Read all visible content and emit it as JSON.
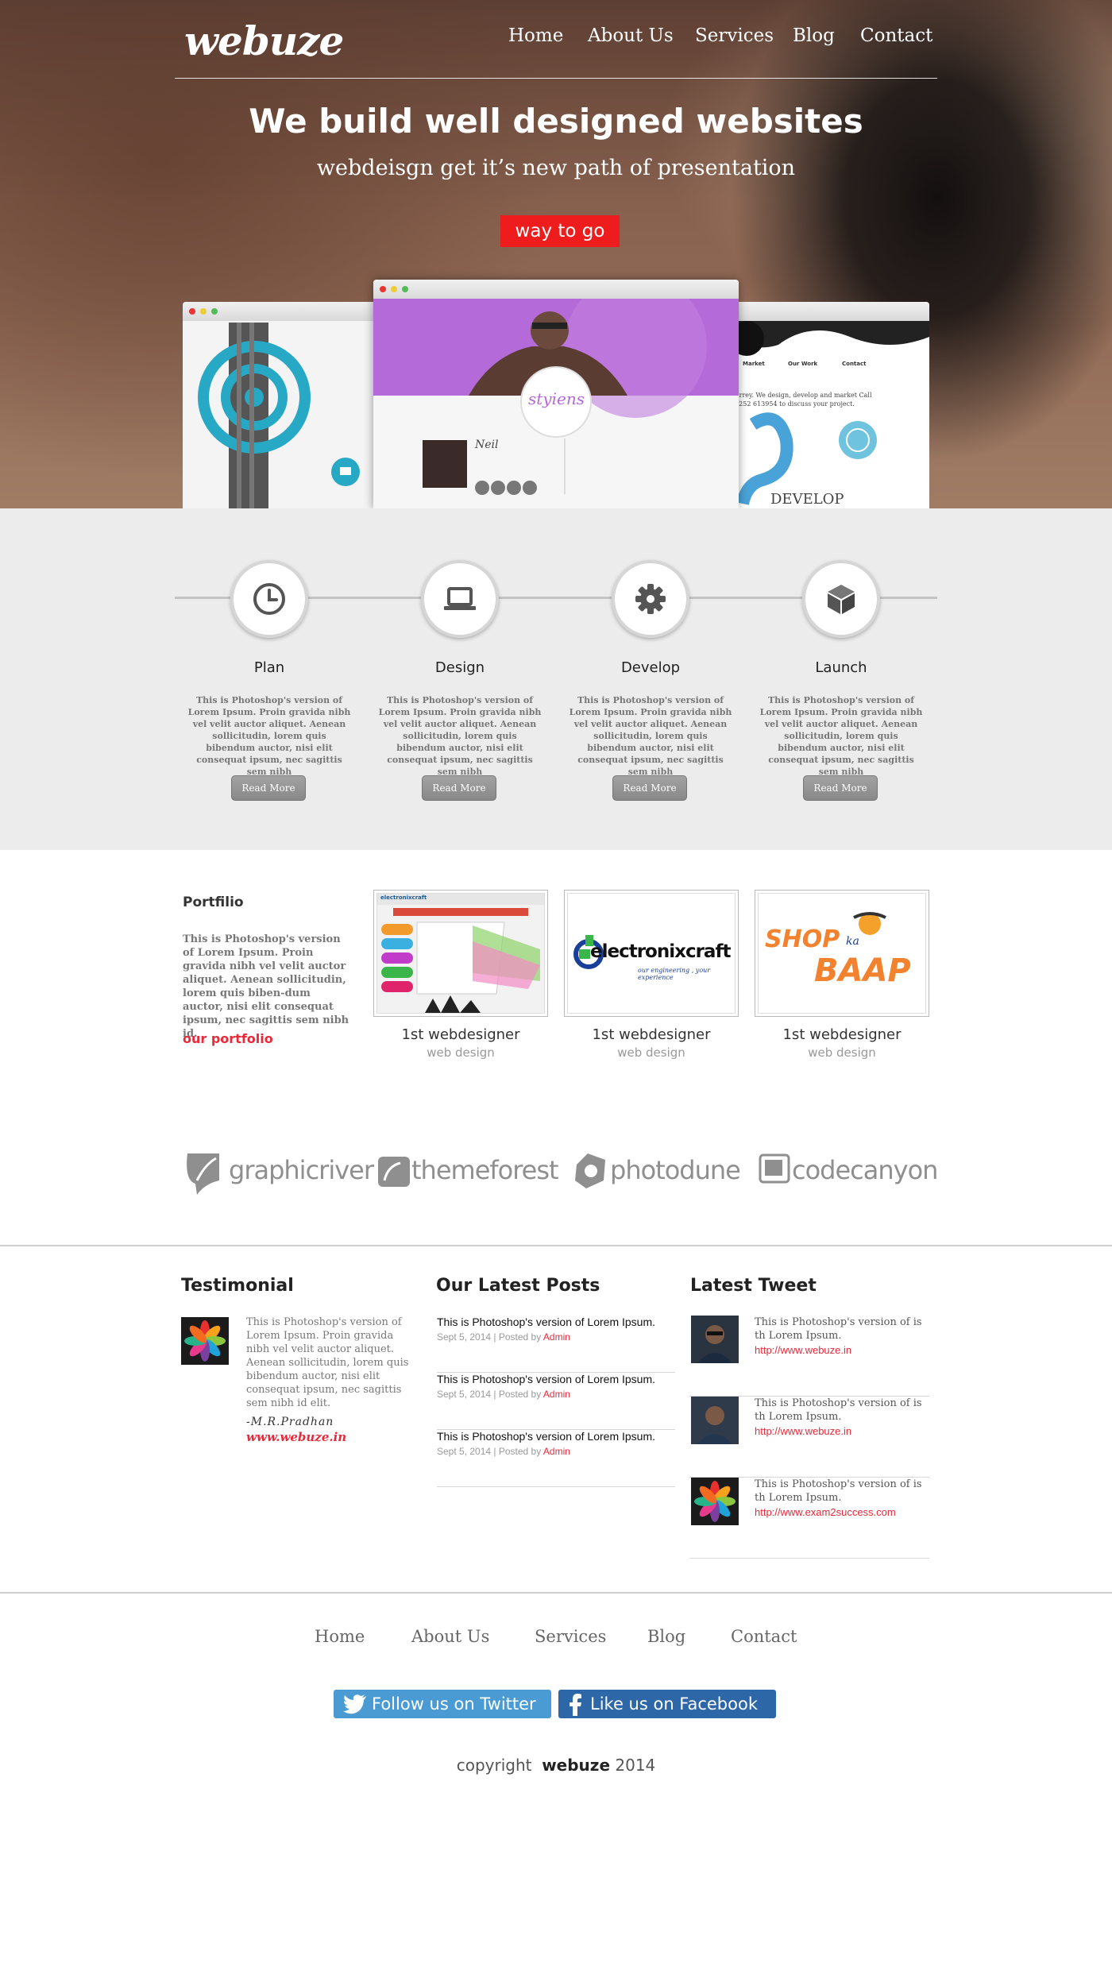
{
  "brand": {
    "logo": "webuze"
  },
  "nav": {
    "items": [
      "Home",
      "About Us",
      "Services",
      "Blog",
      "Contact"
    ]
  },
  "hero": {
    "title": "We build well designed websites",
    "subtitle": "webdeisgn get it’s new path of presentation",
    "cta_label": "way to go"
  },
  "mockups": {
    "center_logo": "styiens",
    "center_name": "Neil",
    "right_title": "DEVELOP",
    "right_menu": [
      "Market",
      "Our Work",
      "Contact"
    ],
    "right_text": "Surrey. We design, develop and market Call 01252 613954 to discuss your project."
  },
  "features": [
    {
      "title": "Plan",
      "icon": "clock-icon",
      "text": "This is Photoshop's version of Lorem Ipsum. Proin gravida nibh vel velit auctor aliquet. Aenean sollicitudin, lorem quis bibendum auctor, nisi elit consequat ipsum, nec sagittis sem nibh",
      "button": "Read More"
    },
    {
      "title": "Design",
      "icon": "laptop-icon",
      "text": "This is Photoshop's version of Lorem Ipsum. Proin gravida nibh vel velit auctor aliquet. Aenean sollicitudin, lorem quis bibendum auctor, nisi elit consequat ipsum, nec sagittis sem nibh",
      "button": "Read More"
    },
    {
      "title": "Develop",
      "icon": "gear-icon",
      "text": "This is Photoshop's version of Lorem Ipsum. Proin gravida nibh vel velit auctor aliquet. Aenean sollicitudin, lorem quis bibendum auctor, nisi elit consequat ipsum, nec sagittis sem nibh",
      "button": "Read More"
    },
    {
      "title": "Launch",
      "icon": "cube-icon",
      "text": "This is Photoshop's version of Lorem Ipsum. Proin gravida nibh vel velit auctor aliquet. Aenean sollicitudin, lorem quis bibendum auctor, nisi elit consequat ipsum, nec sagittis sem nibh",
      "button": "Read More"
    }
  ],
  "portfolio": {
    "title": "Portfilio",
    "text": "This is Photoshop's version of Lorem Ipsum. Proin gravida nibh vel velit auctor aliquet. Aenean sollicitudin, lorem quis biben-dum auctor, nisi elit consequat ipsum, nec sagittis sem nibh id.",
    "link": "our portfolio",
    "items": [
      {
        "title": "1st webdesigner",
        "subtitle": "web design",
        "thumb_text": "electronixcraft"
      },
      {
        "title": "1st webdesigner",
        "subtitle": "web design",
        "thumb_text": "electronixcraft",
        "thumb_tagline": "our engineering , your experience"
      },
      {
        "title": "1st webdesigner",
        "subtitle": "web design",
        "thumb_text": "SHOP",
        "thumb_text2": "BAAP",
        "thumb_text3": "ka"
      }
    ]
  },
  "brands": [
    "graphicriver",
    "themeforest",
    "photodune",
    "codecanyon"
  ],
  "testimonial": {
    "heading": "Testimonial",
    "text": "This is Photoshop's version of Lorem Ipsum. Proin gravida nibh vel velit auctor aliquet. Aenean sollicitudin, lorem quis bibendum auctor, nisi elit consequat ipsum, nec sagittis sem nibh id elit.",
    "author": "-M.R.Pradhan",
    "url": "www.webuze.in"
  },
  "posts": {
    "heading": "Our Latest Posts",
    "items": [
      {
        "title": "This is Photoshop's version of Lorem Ipsum.",
        "date": "Sept 5, 2014",
        "posted_by": "Posted by",
        "author": "Admin"
      },
      {
        "title": "This is Photoshop's version of Lorem Ipsum.",
        "date": "Sept 5, 2014",
        "posted_by": "Posted by",
        "author": "Admin"
      },
      {
        "title": "This is Photoshop's version of Lorem Ipsum.",
        "date": "Sept 5, 2014",
        "posted_by": "Posted by",
        "author": "Admin"
      }
    ]
  },
  "tweets": {
    "heading": "Latest Tweet",
    "items": [
      {
        "text": "This is Photoshop's version of is th Lorem Ipsum.",
        "link": "http://www.webuze.in"
      },
      {
        "text": "This is Photoshop's version of is th Lorem Ipsum.",
        "link": "http://www.webuze.in"
      },
      {
        "text": "This is Photoshop's version of is th Lorem Ipsum.",
        "link": "http://www.exam2success.com"
      }
    ]
  },
  "footer": {
    "nav": [
      "Home",
      "About Us",
      "Services",
      "Blog",
      "Contact"
    ],
    "twitter_label": "Follow us on Twitter",
    "facebook_label": "Like us on Facebook",
    "copyright_prefix": "copyright",
    "copyright_brand": "webuze",
    "copyright_year": "2014"
  },
  "colors": {
    "accent": "#e82a3a",
    "cta": "#ee1c1c",
    "twitter": "#4a9bd3",
    "facebook": "#2d67a8",
    "features_bg": "#ececec"
  }
}
